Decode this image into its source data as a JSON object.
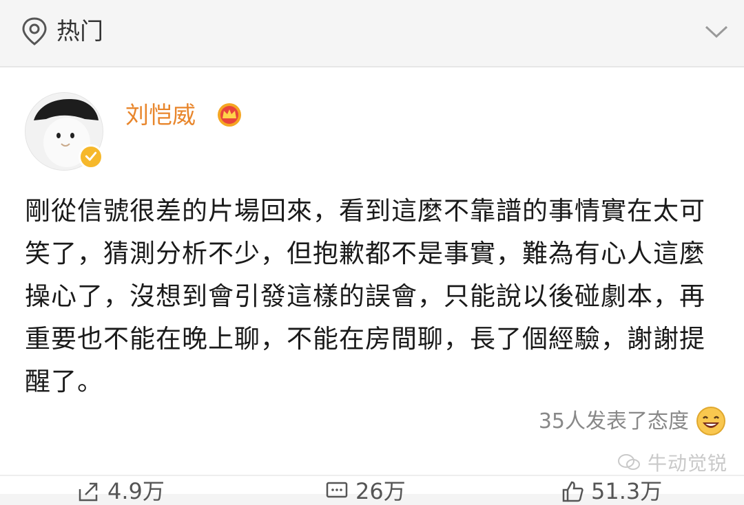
{
  "header": {
    "label": "热门"
  },
  "post": {
    "username": "刘恺威",
    "text": "剛從信號很差的片場回來，看到這麼不靠譜的事情實在太可笑了，猜測分析不少，但抱歉都不是事實，難為有心人這麼操心了，沒想到會引發這樣的誤會，只能說以後碰劇本，再重要也不能在晚上聊，不能在房間聊，長了個經驗，謝謝提醒了。",
    "reactions_text": "35人发表了态度"
  },
  "watermark": {
    "text": "牛动觉锐"
  },
  "actions": {
    "repost_count": "4.9万",
    "comment_count": "26万",
    "like_count": "51.3万"
  },
  "colors": {
    "username": "#e8862c",
    "accent": "#f6b82b"
  },
  "icons": {
    "hot": "location-pin-icon",
    "collapse": "chevron-down-icon",
    "vip": "crown-icon",
    "verified": "verified-badge-icon",
    "reaction": "laughing-emoji-icon",
    "repost": "share-icon",
    "comment": "comment-icon",
    "like": "thumbs-up-icon"
  }
}
